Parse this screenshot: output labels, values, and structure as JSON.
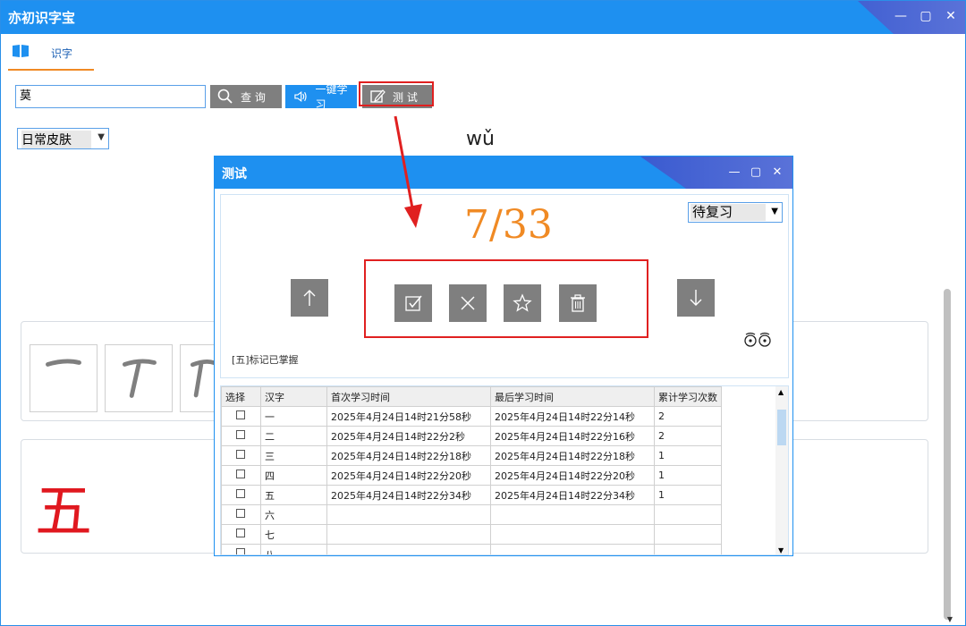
{
  "app": {
    "title": "亦初识字宝"
  },
  "window_controls": {
    "minimize": "—",
    "maximize": "▢",
    "close": "✕"
  },
  "tab": {
    "label": "识字"
  },
  "search": {
    "value": "莫"
  },
  "buttons": {
    "query": "查 询",
    "learn": "一键学习",
    "test": "测 试"
  },
  "skin": {
    "selected": "日常皮肤"
  },
  "pinyin": "wǔ",
  "big_char": "五",
  "dialog": {
    "title": "测试",
    "progress": "7/33",
    "filter": "待复习",
    "mastered_note": "[五]标记已掌握",
    "table": {
      "headers": [
        "选择",
        "汉字",
        "首次学习时间",
        "最后学习时间",
        "累计学习次数"
      ],
      "rows": [
        {
          "char": "一",
          "first": "2025年4月24日14时21分58秒",
          "last": "2025年4月24日14时22分14秒",
          "count": "2"
        },
        {
          "char": "二",
          "first": "2025年4月24日14时22分2秒",
          "last": "2025年4月24日14时22分16秒",
          "count": "2"
        },
        {
          "char": "三",
          "first": "2025年4月24日14时22分18秒",
          "last": "2025年4月24日14时22分18秒",
          "count": "1"
        },
        {
          "char": "四",
          "first": "2025年4月24日14时22分20秒",
          "last": "2025年4月24日14时22分20秒",
          "count": "1"
        },
        {
          "char": "五",
          "first": "2025年4月24日14时22分34秒",
          "last": "2025年4月24日14时22分34秒",
          "count": "1"
        },
        {
          "char": "六",
          "first": "",
          "last": "",
          "count": ""
        },
        {
          "char": "七",
          "first": "",
          "last": "",
          "count": ""
        },
        {
          "char": "八",
          "first": "",
          "last": "",
          "count": ""
        }
      ]
    }
  },
  "colors": {
    "accent": "#1e90f0",
    "orange": "#f08a24",
    "red": "#e02020",
    "button_gray": "#7f7f7f"
  },
  "icons": [
    "book-icon",
    "search-icon",
    "speaker-icon",
    "edit-icon",
    "up-arrow-icon",
    "check-icon",
    "close-icon",
    "star-icon",
    "trash-icon",
    "down-arrow-icon",
    "eyes-icon"
  ]
}
